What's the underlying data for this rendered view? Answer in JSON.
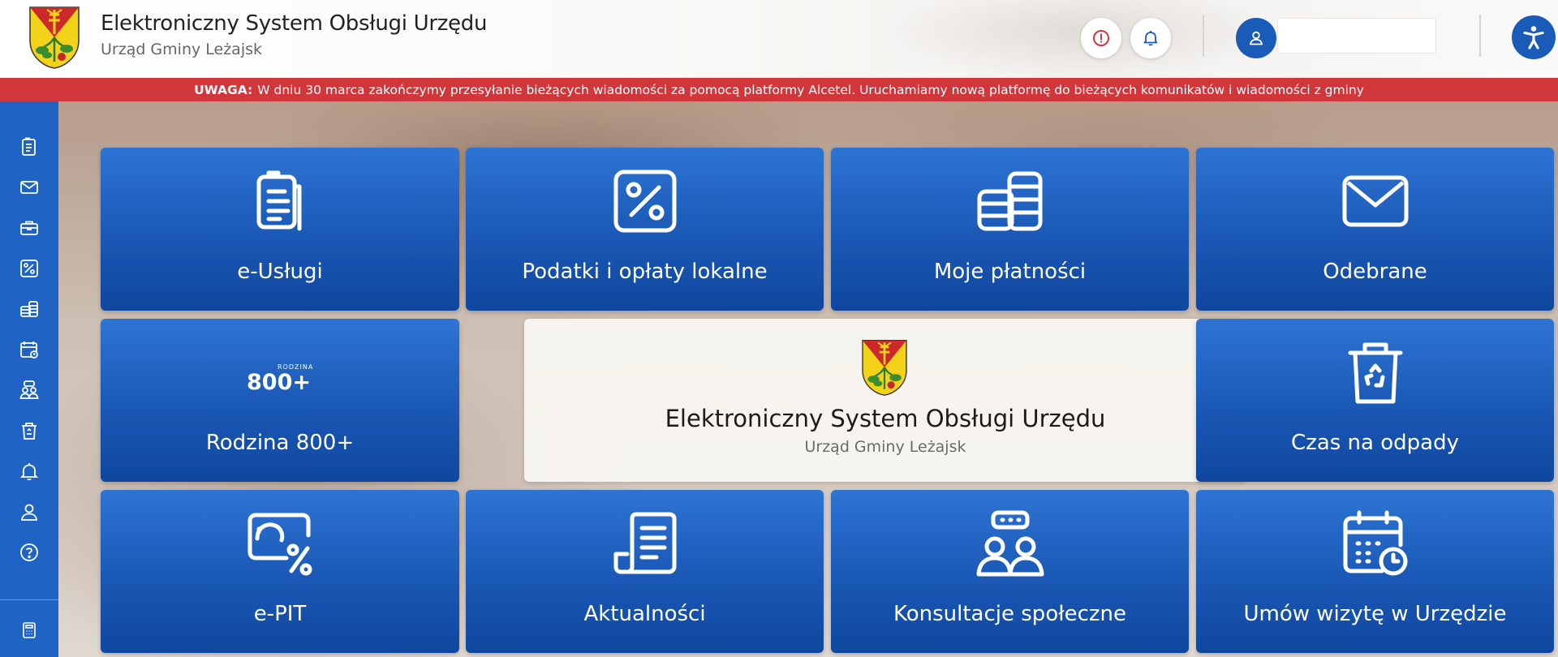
{
  "header": {
    "title": "Elektroniczny System Obsługi Urzędu",
    "subtitle": "Urząd Gminy Leżajsk",
    "user_name": ""
  },
  "alert": {
    "label": "UWAGA:",
    "message": "W dniu 30 marca zakończymy przesyłanie bieżących wiadomości za pomocą platformy Alcetel. Uruchamiamy nową platformę do bieżących komunikatów i wiadomości z gminy"
  },
  "sidebar": {
    "items": [
      {
        "icon": "document-icon"
      },
      {
        "icon": "mail-icon"
      },
      {
        "icon": "briefcase-icon"
      },
      {
        "icon": "percent-icon"
      },
      {
        "icon": "coins-icon"
      },
      {
        "icon": "calendar-icon"
      },
      {
        "icon": "consultation-icon"
      },
      {
        "icon": "trash-icon"
      },
      {
        "icon": "bell-icon"
      },
      {
        "icon": "user-icon"
      },
      {
        "icon": "help-icon"
      },
      {
        "icon": "calculator-icon"
      }
    ]
  },
  "tiles": {
    "e_uslugi": "e-Usługi",
    "podatki": "Podatki i opłaty lokalne",
    "platnosci": "Moje płatności",
    "odebrane": "Odebrane",
    "rodzina": "Rodzina 800+",
    "rodzina_logo_small": "RODZINA",
    "rodzina_logo_big": "800+",
    "odpady": "Czas na odpady",
    "epit": "e-PIT",
    "aktualnosci": "Aktualności",
    "konsultacje": "Konsultacje społeczne",
    "wizyta": "Umów wizytę w Urzędzie"
  },
  "center": {
    "title": "Elektroniczny System Obsługi Urzędu",
    "subtitle": "Urząd Gminy Leżajsk"
  },
  "colors": {
    "primary_blue": "#1a5bb8",
    "alert_red": "#d1363a",
    "sidebar_blue": "#1f63c4"
  }
}
